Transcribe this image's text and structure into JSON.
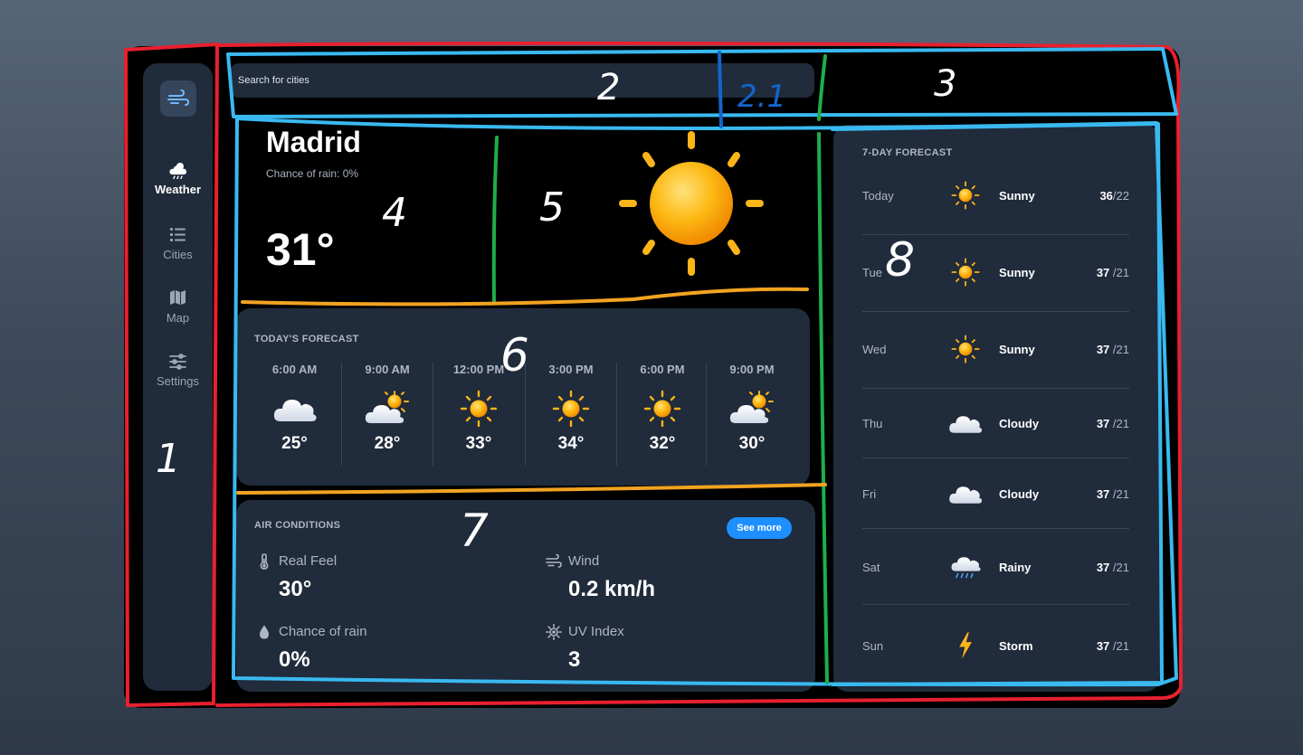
{
  "sidebar": {
    "items": [
      {
        "label": "Weather",
        "icon": "weather-icon",
        "active": true
      },
      {
        "label": "Cities",
        "icon": "list-icon",
        "active": false
      },
      {
        "label": "Map",
        "icon": "map-icon",
        "active": false
      },
      {
        "label": "Settings",
        "icon": "sliders-icon",
        "active": false
      }
    ]
  },
  "search": {
    "placeholder": "Search for cities"
  },
  "current": {
    "city": "Madrid",
    "rain_chance": "Chance of rain: 0%",
    "temperature": "31°",
    "icon": "sun-icon"
  },
  "today_forecast": {
    "title": "TODAY'S FORECAST",
    "hours": [
      {
        "time": "6:00 AM",
        "icon": "cloud-icon",
        "temp": "25°"
      },
      {
        "time": "9:00 AM",
        "icon": "partly-cloudy-icon",
        "temp": "28°"
      },
      {
        "time": "12:00 PM",
        "icon": "sun-icon",
        "temp": "33°"
      },
      {
        "time": "3:00 PM",
        "icon": "sun-icon",
        "temp": "34°"
      },
      {
        "time": "6:00 PM",
        "icon": "sun-icon",
        "temp": "32°"
      },
      {
        "time": "9:00 PM",
        "icon": "partly-cloudy-icon",
        "temp": "30°"
      }
    ]
  },
  "air_conditions": {
    "title": "AIR CONDITIONS",
    "see_more": "See more",
    "items": [
      {
        "label": "Real Feel",
        "value": "30°",
        "icon": "thermometer-icon"
      },
      {
        "label": "Wind",
        "value": "0.2 km/h",
        "icon": "wind-icon"
      },
      {
        "label": "Chance of rain",
        "value": "0%",
        "icon": "droplet-icon"
      },
      {
        "label": "UV Index",
        "value": "3",
        "icon": "sun-outline-icon"
      }
    ]
  },
  "week_forecast": {
    "title": "7-DAY FORECAST",
    "days": [
      {
        "day": "Today",
        "icon": "sun-icon",
        "condition": "Sunny",
        "high": "36",
        "low": "/22"
      },
      {
        "day": "Tue",
        "icon": "sun-icon",
        "condition": "Sunny",
        "high": "37",
        "low": "/21"
      },
      {
        "day": "Wed",
        "icon": "sun-icon",
        "condition": "Sunny",
        "high": "37",
        "low": "/21"
      },
      {
        "day": "Thu",
        "icon": "cloud-icon",
        "condition": "Cloudy",
        "high": "37",
        "low": "/21"
      },
      {
        "day": "Fri",
        "icon": "cloud-icon",
        "condition": "Cloudy",
        "high": "37",
        "low": "/21"
      },
      {
        "day": "Sat",
        "icon": "rain-cloud-icon",
        "condition": "Rainy",
        "high": "37",
        "low": "/21"
      },
      {
        "day": "Sun",
        "icon": "lightning-icon",
        "condition": "Storm",
        "high": "37",
        "low": "/21"
      }
    ]
  },
  "annotations": {
    "labels": [
      "1",
      "2",
      "2.1",
      "3",
      "4",
      "5",
      "6",
      "7",
      "8"
    ],
    "colors": {
      "red": "#e8202f",
      "blue": "#39b9f0",
      "green": "#1fae4a",
      "orange": "#f2a321",
      "dark_blue": "#1166cc"
    }
  },
  "colors": {
    "card": "#202b3b",
    "frame": "#000000",
    "accent": "#1d8fff",
    "sun": "#fbb41a"
  }
}
